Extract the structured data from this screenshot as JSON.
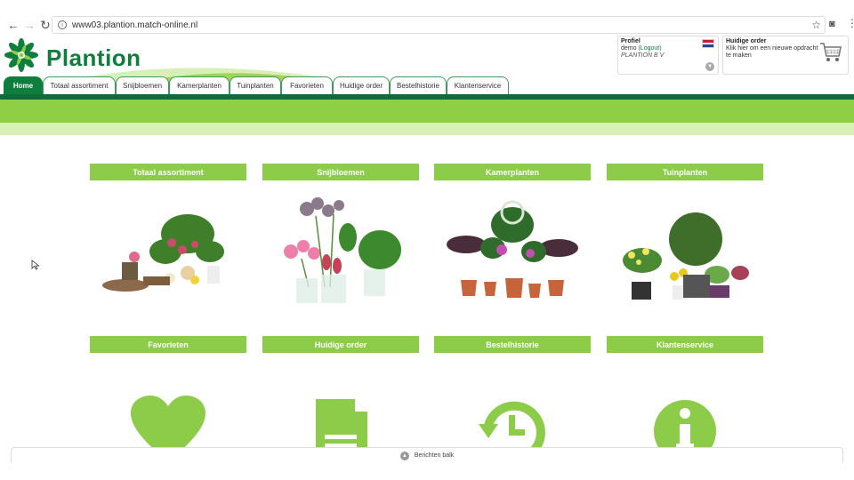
{
  "browser": {
    "url": "www03.plantion.match-online.nl",
    "back_icon": "arrow-left-icon",
    "forward_icon": "arrow-right-icon",
    "reload_icon": "reload-icon"
  },
  "brand": {
    "name": "Plantion",
    "color_dark": "#0f7d3c",
    "color_green": "#8dcc48"
  },
  "profile": {
    "title": "Profiel",
    "user": "demo",
    "logout": "(Logout)",
    "company": "PLANTION B V"
  },
  "order": {
    "title": "Huidige order",
    "line1": "Klik hier om een nieuwe opdracht",
    "line2": "te maken"
  },
  "tabs": [
    {
      "label": "Home"
    },
    {
      "label": "Totaal assortiment"
    },
    {
      "label": "Snijbloemen"
    },
    {
      "label": "Kamerplanten"
    },
    {
      "label": "Tuinplanten"
    },
    {
      "label": "Favorieten"
    },
    {
      "label": "Huidige order"
    },
    {
      "label": "Bestelhistorie"
    },
    {
      "label": "Klantenservice"
    }
  ],
  "tiles_top": [
    {
      "label": "Totaal assortiment"
    },
    {
      "label": "Snijbloemen"
    },
    {
      "label": "Kamerplanten"
    },
    {
      "label": "Tuinplanten"
    }
  ],
  "tiles_bottom": [
    {
      "label": "Favorieten",
      "icon": "heart-icon"
    },
    {
      "label": "Huidige order",
      "icon": "document-icon"
    },
    {
      "label": "Bestelhistorie",
      "icon": "history-icon"
    },
    {
      "label": "Klantenservice",
      "icon": "info-icon"
    }
  ],
  "footer": {
    "berichten": "Berichten balk"
  }
}
